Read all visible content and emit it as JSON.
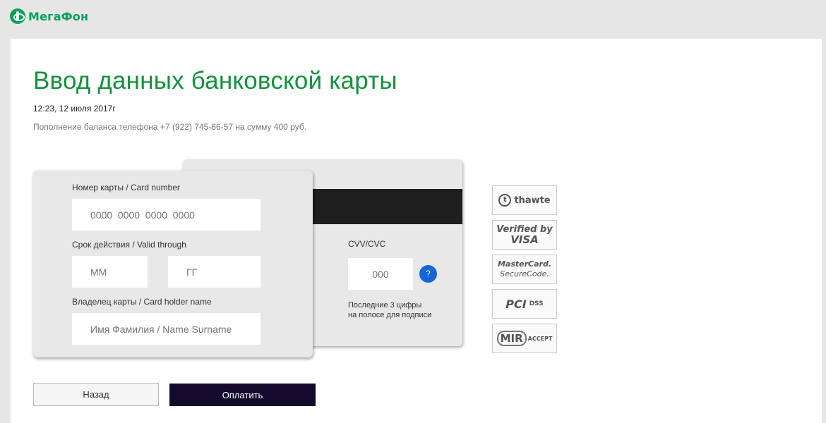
{
  "brand": {
    "name": "МегаФон",
    "color": "#00a15c",
    "icon": "megafon-logo-icon"
  },
  "page": {
    "title": "Ввод данных банковской карты",
    "datetime": "12:23, 12 июля 2017г",
    "description": "Пополнение баланса телефона +7 (922) 745-66-57 на сумму 400 руб."
  },
  "card_front": {
    "number_label": "Номер карты / Card number",
    "number_placeholder": "0000  0000  0000  0000",
    "expiry_label": "Срок действия / Valid through",
    "month_placeholder": "ММ",
    "year_placeholder": "ГГ",
    "holder_label": "Владелец карты / Card holder name",
    "holder_placeholder": "Имя Фамилия / Name Surname"
  },
  "card_back": {
    "cvv_label": "CVV/CVC",
    "cvv_placeholder": "000",
    "help_label": "?",
    "hint_line1": "Последние 3 цифры",
    "hint_line2": "на полосе для подписи"
  },
  "badges": [
    {
      "icon": "thawte-icon",
      "text": "thawte"
    },
    {
      "icon": "verified-by-visa-icon",
      "text1": "Verified by",
      "text2": "VISA"
    },
    {
      "icon": "mastercard-securecode-icon",
      "text1": "MasterCard.",
      "text2": "SecureCode."
    },
    {
      "icon": "pci-dss-icon",
      "text1": "PCI",
      "text2": "DSS"
    },
    {
      "icon": "mir-accept-icon",
      "text1": "MIR",
      "text2": "ACCEPT"
    }
  ],
  "buttons": {
    "back": "Назад",
    "pay": "Оплатить"
  },
  "colors": {
    "title": "#14913c",
    "pay_button": "#140a2d",
    "help_icon": "#1565d8"
  }
}
